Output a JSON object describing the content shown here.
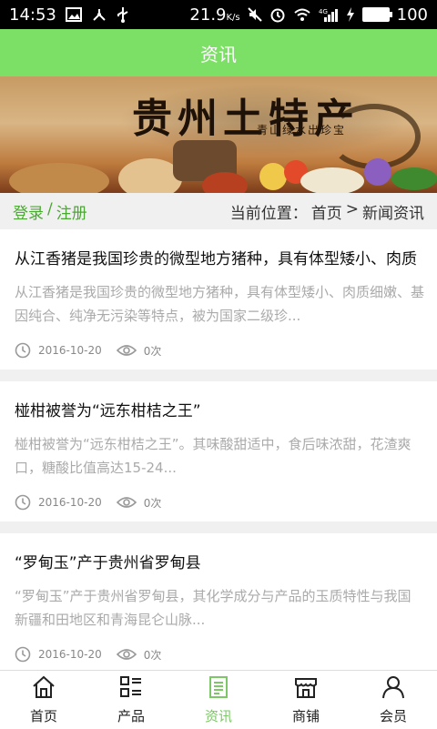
{
  "status": {
    "time": "14:53",
    "speed": "21.9",
    "speed_unit": "K/s",
    "network": "4G",
    "battery": "100",
    "battery_level": 1.0
  },
  "header": {
    "title": "资讯"
  },
  "banner": {
    "title": "贵州土特产",
    "subtitle": "青山绿水出珍宝"
  },
  "crumbbar": {
    "login": "登录",
    "separator": "/",
    "register": "注册",
    "location_label": "当前位置：",
    "home": "首页",
    "arrow": ">",
    "current": "新闻资讯"
  },
  "articles": [
    {
      "title": "从江香猪是我国珍贵的微型地方猪种，具有体型矮小、肉质",
      "summary": "从江香猪是我国珍贵的微型地方猪种，具有体型矮小、肉质细嫩、基因纯合、纯净无污染等特点，被为国家二级珍...",
      "date": "2016-10-20",
      "views": "0次"
    },
    {
      "title": "椪柑被誉为“远东柑桔之王”",
      "summary": "椪柑被誉为“远东柑桔之王”。其味酸甜适中，食后味浓甜，花渣爽口，糖酸比值高达15-24...",
      "date": "2016-10-20",
      "views": "0次"
    },
    {
      "title": "“罗甸玉”产于贵州省罗甸县",
      "summary": "“罗甸玉”产于贵州省罗甸县，其化学成分与产品的玉质特性与我国新疆和田地区和青海昆仑山脉...",
      "date": "2016-10-20",
      "views": "0次"
    }
  ],
  "tabs": [
    {
      "label": "首页",
      "icon": "home-icon"
    },
    {
      "label": "产品",
      "icon": "grid-list-icon"
    },
    {
      "label": "资讯",
      "icon": "document-icon",
      "active": true
    },
    {
      "label": "商铺",
      "icon": "store-icon"
    },
    {
      "label": "会员",
      "icon": "user-icon"
    }
  ],
  "colors": {
    "accent": "#7ce066",
    "link": "#4aa832",
    "active_tab": "#7cc766"
  }
}
